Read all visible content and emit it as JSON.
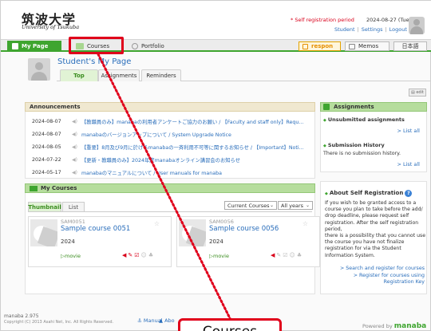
{
  "header": {
    "logo_jp": "筑波大学",
    "logo_en": "University of Tsukuba",
    "self_reg": "* Self registration period",
    "date": "2024-08-27 (Tue)",
    "links": [
      "Student",
      "Settings",
      "Logout"
    ]
  },
  "nav": {
    "mypage": "My Page",
    "courses": "Courses",
    "portfolio": "Portfolio",
    "respon": "respon",
    "memos": "Memos",
    "lang": "日本語"
  },
  "user": {
    "title": "Student's My Page",
    "tabs": [
      "Top",
      "Assignments",
      "Reminders"
    ]
  },
  "announcements": {
    "title": "Announcements",
    "items": [
      {
        "date": "2024-08-07",
        "text": "【教職員のみ】manabaの利用者アンケートご協力のお願い / 【Faculty and staff only】Requ..."
      },
      {
        "date": "2024-08-07",
        "text": "manabaのバージョンアップについて / System Upgrade Notice"
      },
      {
        "date": "2024-08-05",
        "text": "【重要】8月及び9月に於けるmanabaの一斉利用不可等に関するお知らせ / 【Important】Noti..."
      },
      {
        "date": "2024-07-22",
        "text": "【更新・教職員のみ】2024年度manabaオンライン講習会のお知らせ"
      },
      {
        "date": "2024-05-17",
        "text": "manabaのマニュアルについて / User manuals for manaba"
      }
    ]
  },
  "my_courses": {
    "title": "My Courses",
    "tabs": [
      "Thumbnail",
      "List"
    ],
    "filter": "Current Courses",
    "year": "All years",
    "cards": [
      {
        "code": "SAM0051",
        "name": "Sample course 0051",
        "year": "2024",
        "movie": "movie"
      },
      {
        "code": "SAM0056",
        "name": "Sample course 0056",
        "year": "2024",
        "movie": "movie"
      }
    ]
  },
  "assignments": {
    "title": "Assignments",
    "unsubmitted": "Unsubmitted assignments",
    "list_all": "> List all",
    "history": "Submission History",
    "no_history": "There is no submission history.",
    "list_all2": "> List all"
  },
  "self_registration": {
    "title": "About Self Registration",
    "para1": "If you wish to be granted access to a course you plan to take before the add/ drop deadline, please request self registration. After the self registration period,",
    "para2": "there is a possibility that you cannot use the course you have not finalize registration for via the Student Information System.",
    "link1": "> Search and register for courses",
    "link2a": "> Register for courses using",
    "link2b": "Registration Key"
  },
  "footer": {
    "version": "manaba 2.975",
    "copyright": "Copyright (C) 2013 Asahi Net, Inc. All Rights Reserved.",
    "manual": "Manual",
    "about": "Abo",
    "powered": "Powered by",
    "brand": "manaba"
  },
  "callout": "Courses",
  "colors": {
    "accent_green": "#3ea52f",
    "highlight_red": "#e0001b",
    "link_blue": "#2a6ebb"
  }
}
